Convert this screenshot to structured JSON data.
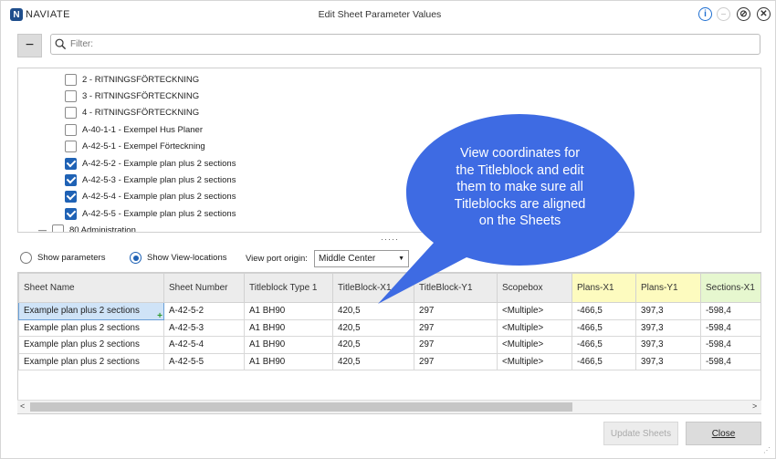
{
  "titlebar": {
    "logo_text": "NAVIATE",
    "logo_letter": "N",
    "title": "Edit Sheet Parameter Values"
  },
  "filter": {
    "collapse_label": "−",
    "placeholder": "Filter:"
  },
  "tree": {
    "items": [
      {
        "label": "2 - RITNINGSFÖRTECKNING",
        "checked": false
      },
      {
        "label": "3 - RITNINGSFÖRTECKNING",
        "checked": false
      },
      {
        "label": "4 - RITNINGSFÖRTECKNING",
        "checked": false
      },
      {
        "label": "A-40-1-1 - Exempel Hus Planer",
        "checked": false
      },
      {
        "label": "A-42-5-1 - Exempel Förteckning",
        "checked": false
      },
      {
        "label": "A-42-5-2 - Example plan plus 2 sections",
        "checked": true
      },
      {
        "label": "A-42-5-3 - Example plan plus 2 sections",
        "checked": true
      },
      {
        "label": "A-42-5-4 - Example plan plus 2 sections",
        "checked": true
      },
      {
        "label": "A-42-5-5 - Example plan plus 2 sections",
        "checked": true
      }
    ],
    "partial_item": "80 Administration"
  },
  "options": {
    "show_parameters": "Show parameters",
    "show_view_locations": "Show View-locations",
    "selected": "show_view_locations",
    "origin_label": "View port origin:",
    "origin_value": "Middle Center"
  },
  "grid": {
    "columns": [
      "Sheet Name",
      "Sheet Number",
      "Titleblock Type 1",
      "TitleBlock-X1",
      "TitleBlock-Y1",
      "Scopebox",
      "Plans-X1",
      "Plans-Y1",
      "Sections-X1"
    ],
    "rows": [
      [
        "Example plan plus 2 sections",
        "A-42-5-2",
        "A1 BH90",
        "420,5",
        "297",
        "<Multiple>",
        "-466,5",
        "397,3",
        "-598,4"
      ],
      [
        "Example plan plus 2 sections",
        "A-42-5-3",
        "A1 BH90",
        "420,5",
        "297",
        "<Multiple>",
        "-466,5",
        "397,3",
        "-598,4"
      ],
      [
        "Example plan plus 2 sections",
        "A-42-5-4",
        "A1 BH90",
        "420,5",
        "297",
        "<Multiple>",
        "-466,5",
        "397,3",
        "-598,4"
      ],
      [
        "Example plan plus 2 sections",
        "A-42-5-5",
        "A1 BH90",
        "420,5",
        "297",
        "<Multiple>",
        "-466,5",
        "397,3",
        "-598,4"
      ]
    ]
  },
  "buttons": {
    "update": "Update Sheets",
    "close": "Close"
  },
  "callout": {
    "lines": [
      "View coordinates for",
      "the Titleblock and edit",
      "them to make sure all",
      "Titleblocks are aligned",
      "on the Sheets"
    ]
  },
  "colors": {
    "callout_fill": "#3e6be3",
    "accent": "#1f62b5",
    "plans_header": "#fdfbbf",
    "sections_header": "#e6f7cf"
  }
}
